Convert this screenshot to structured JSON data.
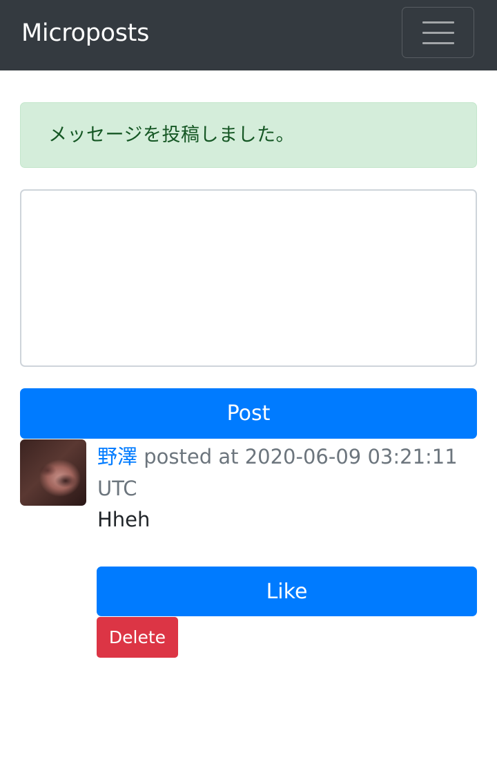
{
  "navbar": {
    "brand": "Microposts",
    "toggler_icon": "hamburger-menu-icon",
    "background": "#343a40"
  },
  "alert": {
    "message": "メッセージを投稿しました。",
    "background": "#d4edda",
    "text_color": "#155724"
  },
  "form": {
    "content_value": "",
    "content_placeholder": "",
    "post_label": "Post",
    "button_color": "#007bff"
  },
  "microposts": [
    {
      "avatar_icon": "user-avatar",
      "user_name": "野澤",
      "posted_text": " posted at 2020-06-09 03:21:11 UTC",
      "content": "Hheh",
      "like_label": "Like",
      "delete_label": "Delete",
      "delete_color": "#dc3545"
    }
  ]
}
